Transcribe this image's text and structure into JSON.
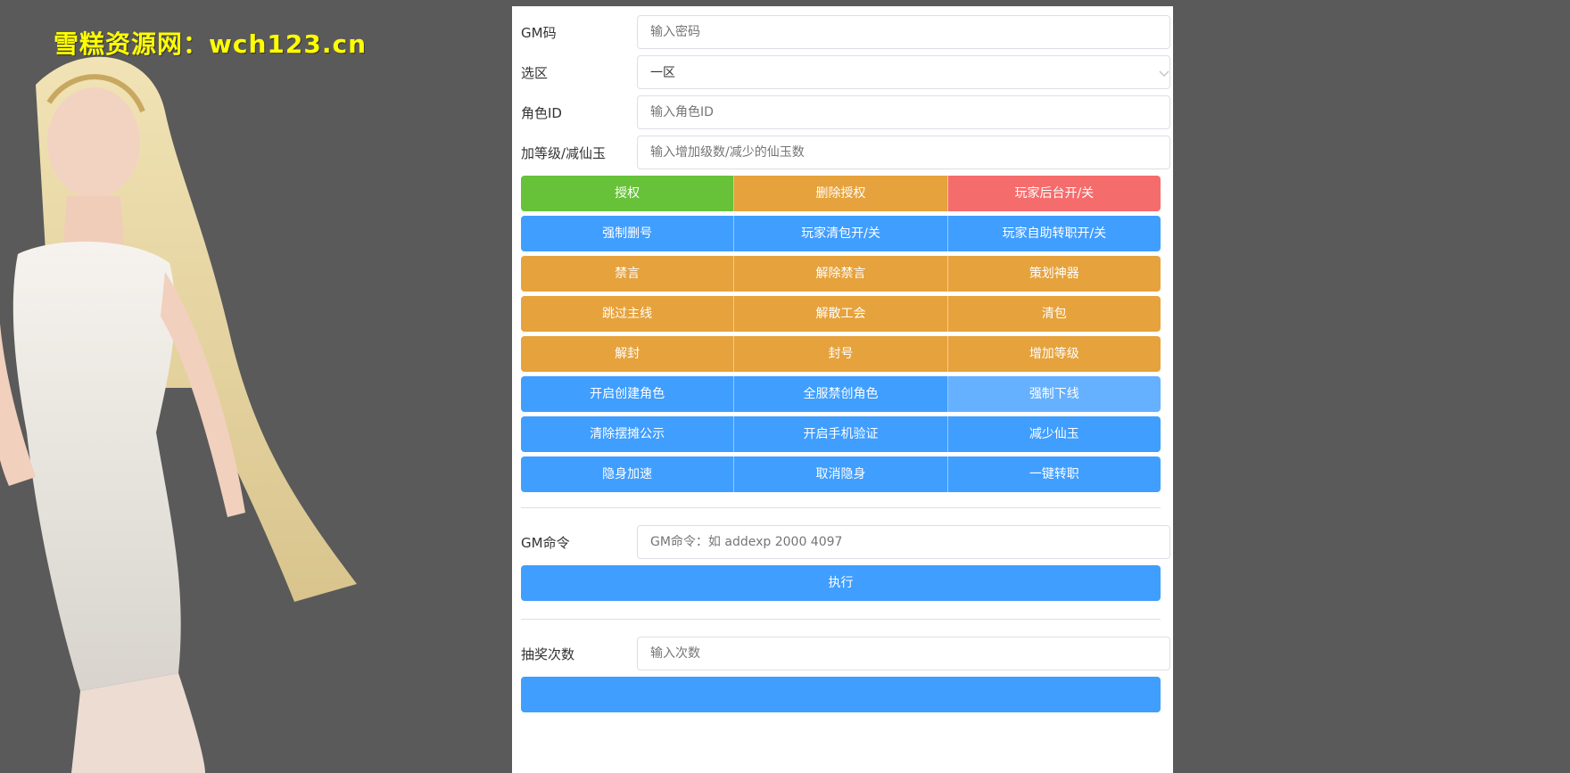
{
  "watermark": "雪糕资源网：wch123.cn",
  "form": {
    "gm_code": {
      "label": "GM码",
      "placeholder": "输入密码"
    },
    "zone": {
      "label": "选区",
      "value": "一区"
    },
    "role_id": {
      "label": "角色ID",
      "placeholder": "输入角色ID"
    },
    "level": {
      "label": "加等级/减仙玉",
      "placeholder": "输入增加级数/减少的仙玉数"
    }
  },
  "button_rows": [
    [
      "授权",
      "删除授权",
      "玩家后台开/关"
    ],
    [
      "强制删号",
      "玩家清包开/关",
      "玩家自助转职开/关"
    ],
    [
      "禁言",
      "解除禁言",
      "策划神器"
    ],
    [
      "跳过主线",
      "解散工会",
      "清包"
    ],
    [
      "解封",
      "封号",
      "增加等级"
    ],
    [
      "开启创建角色",
      "全服禁创角色",
      "强制下线"
    ],
    [
      "清除摆摊公示",
      "开启手机验证",
      "减少仙玉"
    ],
    [
      "隐身加速",
      "取消隐身",
      "一键转职"
    ]
  ],
  "gm_command": {
    "label": "GM命令",
    "placeholder": "GM命令：如 addexp 2000 4097",
    "execute_label": "执行"
  },
  "lottery": {
    "label": "抽奖次数",
    "placeholder": "输入次数"
  },
  "colors": {
    "green": "#67c23a",
    "orange": "#e6a23c",
    "red": "#f56c6c",
    "blue": "#409eff",
    "light_blue": "#66b1ff"
  }
}
